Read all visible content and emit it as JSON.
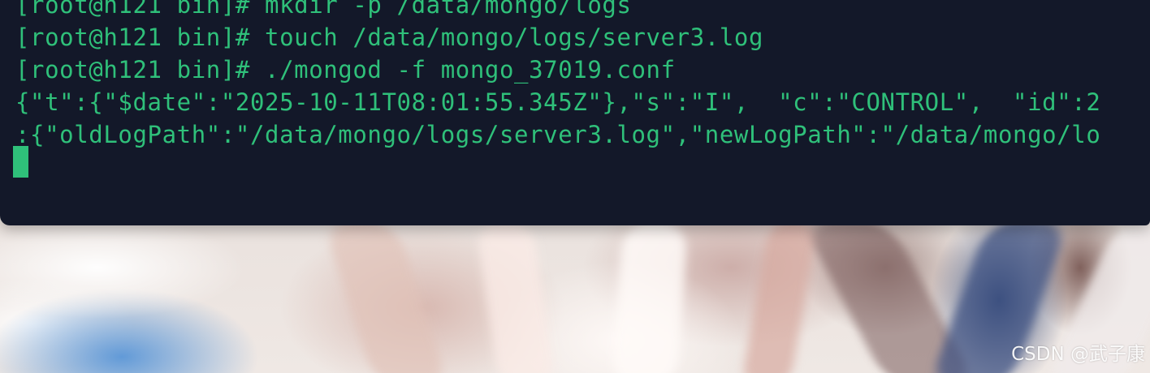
{
  "terminal": {
    "lines": [
      "[root@h121 bin]# mkdir -p /data/mongo/logs",
      "[root@h121 bin]# touch /data/mongo/logs/server3.log",
      "[root@h121 bin]# ./mongod -f mongo_37019.conf",
      "{\"t\":{\"$date\":\"2025-10-11T08:01:55.345Z\"},\"s\":\"I\",  \"c\":\"CONTROL\",  \"id\":2",
      ":{\"oldLogPath\":\"/data/mongo/logs/server3.log\",\"newLogPath\":\"/data/mongo/lo"
    ],
    "text_color": "#2fc07a",
    "background_color": "#131829"
  },
  "watermark": {
    "text": "CSDN @武子康"
  }
}
